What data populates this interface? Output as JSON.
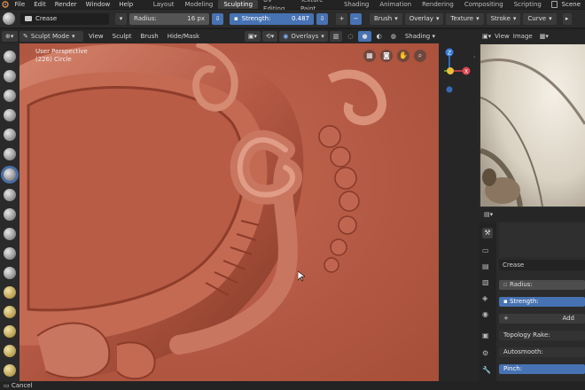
{
  "top_menu": {
    "items": [
      "File",
      "Edit",
      "Render",
      "Window",
      "Help"
    ],
    "workspaces": [
      "Layout",
      "Modeling",
      "Sculpting",
      "UV Editing",
      "Texture Paint",
      "Shading",
      "Animation",
      "Rendering",
      "Compositing",
      "Scripting"
    ],
    "active_workspace": "Sculpting",
    "scene_label": "Scene"
  },
  "tool_header": {
    "brush_name": "Crease",
    "radius_label": "Radius:",
    "radius_value": "16 px",
    "strength_label": "Strength:",
    "strength_value": "0.487",
    "dropdowns": [
      "Brush",
      "Overlay",
      "Texture",
      "Stroke",
      "Curve"
    ]
  },
  "viewport_header": {
    "mode": "Sculpt Mode",
    "menus": [
      "View",
      "Sculpt",
      "Brush",
      "Hide/Mask"
    ],
    "overlays": "Overlays",
    "shading": "Shading"
  },
  "viewport": {
    "view_name": "User Perspective",
    "object_info": "(226) Circle"
  },
  "image_editor": {
    "menus": [
      "View",
      "Image"
    ]
  },
  "properties": {
    "brush_name": "Crease",
    "radius_label": "Radius:",
    "strength_label": "Strength:",
    "add_label": "Add",
    "topology_rake_label": "Topology Rake:",
    "autosmooth_label": "Autosmooth:",
    "pinch_label": "Pinch:"
  },
  "status": {
    "text": "Cancel"
  },
  "colors": {
    "accent_blue": "#4772b3",
    "clay": "#b95a44",
    "panel_bg": "#2b2b2b"
  }
}
